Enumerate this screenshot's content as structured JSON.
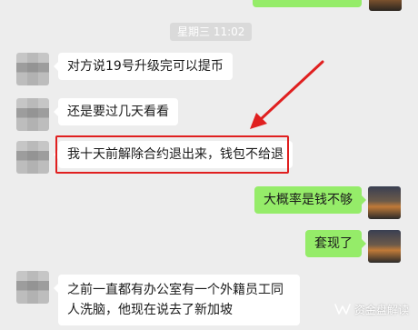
{
  "timestamp": "星期三 11:02",
  "messages": [
    {
      "side": "left",
      "text": "对方说19号升级完可以提币"
    },
    {
      "side": "left",
      "text": "还是要过几天看看"
    },
    {
      "side": "left",
      "text": "我十天前解除合约退出来，钱包不给退"
    },
    {
      "side": "right",
      "text": "大概率是钱不够"
    },
    {
      "side": "right",
      "text": "套现了"
    },
    {
      "side": "left",
      "text": "之前一直都有办公室有一个外籍员工同人洗脑，他现在说去了新加坡"
    }
  ],
  "watermark": {
    "text": "资金盘解读",
    "icon": "wechat-channel-icon"
  },
  "colors": {
    "background": "#ededed",
    "bubble_left": "#ffffff",
    "bubble_right": "#95ec69",
    "highlight": "#e02020",
    "arrow": "#e02020"
  }
}
